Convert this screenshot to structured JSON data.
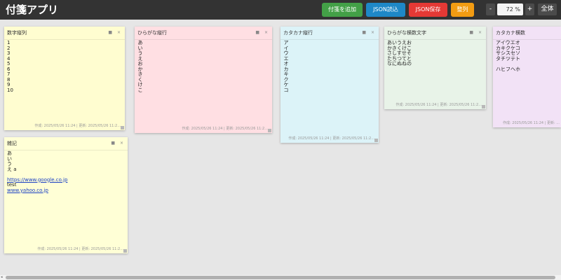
{
  "app": {
    "title": "付箋アプリ"
  },
  "toolbar": {
    "add_label": "付箋を追加",
    "load_label": "JSON読込",
    "save_label": "JSON保存",
    "arrange_label": "整列",
    "zoom_out_label": "-",
    "zoom_value": "72 %",
    "zoom_in_label": "+",
    "fit_label": "全体",
    "colors": {
      "add": "#43a047",
      "load": "#1e88c7",
      "save": "#e53935",
      "arrange": "#f39c12"
    }
  },
  "notes": [
    {
      "title": "数字縦列",
      "color": "#fffdd0",
      "lines": [
        "1",
        "2",
        "3",
        "4",
        "5",
        "6",
        "7",
        "8",
        "9",
        "10"
      ],
      "footer": "作成: 2025/05/26 11:24 | 更新: 2025/05/26 11:2..."
    },
    {
      "title": "ひらがな縦行",
      "color": "#ffdfe3",
      "vertical_text": "あいうえおかきくけこ",
      "footer": "作成: 2025/05/26 11:24 | 更新: 2025/05/26 11:2..."
    },
    {
      "title": "カタカナ縦行",
      "color": "#dcf3f8",
      "vertical_text": "アイウエオカキクケコ",
      "footer": "作成: 2025/05/26 11:24 | 更新: 2025/05/26 11:2..."
    },
    {
      "title": "ひらがな横数文字",
      "color": "#e8f3e8",
      "lines": [
        "あいうえお",
        "かきくけこ",
        "さしすせそ",
        "たちつてと",
        "なにぬねの"
      ],
      "footer": "作成: 2025/05/26 11:24 | 更新: 2025/05/26 11:2..."
    },
    {
      "title": "カタカナ横数",
      "color": "#f2e2f6",
      "lines": [
        "アイウエオ",
        "カキクケコ",
        "サシスセソ",
        "タチツテト",
        "",
        "ハヒフヘホ"
      ],
      "footer": "作成: 2025/05/26 11:24 | 更新: ..."
    },
    {
      "title": "雑記",
      "color": "#ffffd6",
      "lines": [
        "あ",
        "い",
        "う",
        "え a"
      ],
      "link1": "https://www.google.co.jp",
      "mid": "test",
      "link2": "www.yahoo.co.jp",
      "footer": "作成: 2025/05/26 11:24 | 更新: 2025/05/26 11:2..."
    }
  ]
}
